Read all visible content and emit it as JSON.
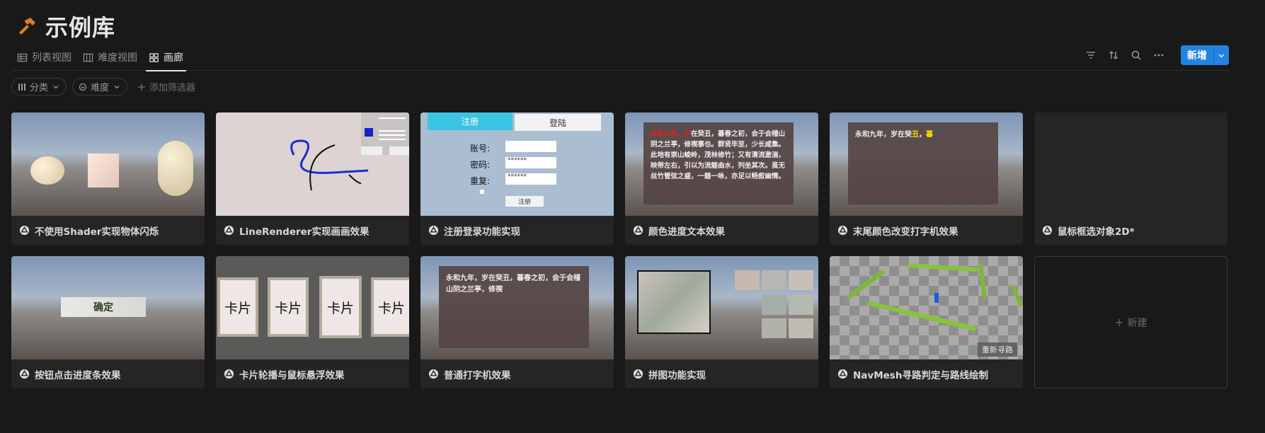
{
  "header": {
    "title": "示例库",
    "icon": "hammer-icon",
    "icon_color": "#e07b26"
  },
  "tabs": [
    {
      "label": "列表视图",
      "icon": "table-icon"
    },
    {
      "label": "难度视图",
      "icon": "board-icon"
    },
    {
      "label": "画廊",
      "icon": "gallery-icon",
      "active": true
    }
  ],
  "toolbar": {
    "new_label": "新增",
    "accent": "#2383e2"
  },
  "filters": {
    "category": "分类",
    "difficulty": "难度",
    "add_filter": "添加筛选器"
  },
  "cards": [
    {
      "title": "不使用Shader实现物体闪烁"
    },
    {
      "title": "LineRenderer实现画画效果"
    },
    {
      "title": "注册登录功能实现"
    },
    {
      "title": "颜色进度文本效果"
    },
    {
      "title": "末尾颜色改变打字机效果"
    },
    {
      "title": "鼠标框选对象2D*"
    },
    {
      "title": "按钮点击进度条效果"
    },
    {
      "title": "卡片轮播与鼠标悬浮效果"
    },
    {
      "title": "普通打字机效果"
    },
    {
      "title": "拼图功能实现"
    },
    {
      "title": "NavMesh寻路判定与路线绘制"
    }
  ],
  "new_card_label": "新建",
  "thumbs": {
    "login": {
      "tab_register": "注册",
      "tab_login": "登陆",
      "account": "账号:",
      "password": "密码:",
      "repeat": "重复:",
      "masked": "******",
      "register_btn": "注册"
    },
    "color_text": {
      "red_part": "永和九年，",
      "red_tail": "岁",
      "rest": "在癸丑，暮春之初，会于会稽山阴之兰亭，修禊事也。群贤毕至，少长咸集。此地有崇山峻岭，茂林修竹；又有清流激湍，映带左右，引以为流觞曲水，列坐其次。虽无丝竹管弦之盛，一觞一咏，亦足以畅叙幽情。"
    },
    "tail_text": {
      "pre": "永和九年，岁在癸",
      "yellow1": "丑",
      "mid": "，",
      "yellow2": "暮"
    },
    "confirm": "确定",
    "card_label": "卡片",
    "typer": "永和九年，岁在癸丑，暮春之初，会于会稽山阴之兰亭，修禊",
    "reroute": "重新寻路"
  }
}
